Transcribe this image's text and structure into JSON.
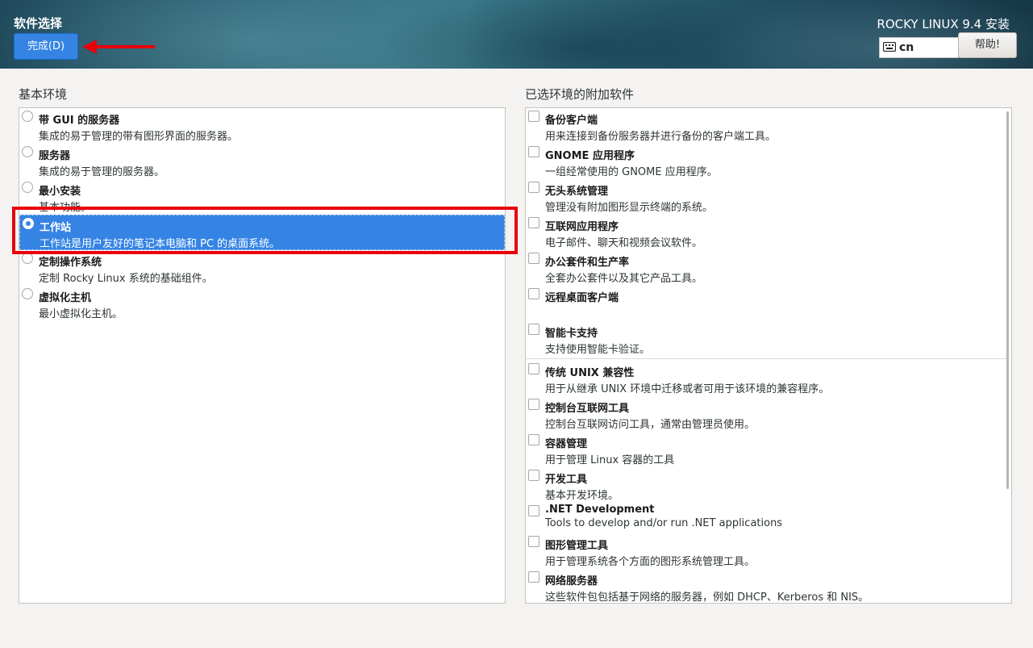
{
  "header": {
    "spoke_title": "软件选择",
    "done_label": "完成(D)",
    "product_title": "ROCKY LINUX 9.4 安装",
    "keyboard_layout": "cn",
    "help_label": "帮助!"
  },
  "base_env": {
    "label": "基本环境",
    "items": [
      {
        "name": "带 GUI 的服务器",
        "desc": "集成的易于管理的带有图形界面的服务器。",
        "selected": false
      },
      {
        "name": "服务器",
        "desc": "集成的易于管理的服务器。",
        "selected": false
      },
      {
        "name": "最小安装",
        "desc": "基本功能。",
        "selected": false
      },
      {
        "name": "工作站",
        "desc": "工作站是用户友好的笔记本电脑和 PC 的桌面系统。",
        "selected": true
      },
      {
        "name": "定制操作系统",
        "desc": "定制 Rocky Linux 系统的基础组件。",
        "selected": false
      },
      {
        "name": "虚拟化主机",
        "desc": "最小虚拟化主机。",
        "selected": false
      }
    ]
  },
  "addons": {
    "label": "已选环境的附加软件",
    "items": [
      {
        "name": "备份客户端",
        "desc": "用来连接到备份服务器并进行备份的客户端工具。"
      },
      {
        "name": "GNOME 应用程序",
        "desc": "一组经常使用的 GNOME 应用程序。"
      },
      {
        "name": "无头系统管理",
        "desc": "管理没有附加图形显示终端的系统。"
      },
      {
        "name": "互联网应用程序",
        "desc": "电子邮件、聊天和视频会议软件。"
      },
      {
        "name": "办公套件和生产率",
        "desc": "全套办公套件以及其它产品工具。"
      },
      {
        "name": "远程桌面客户端",
        "desc": ""
      },
      {
        "name": "智能卡支持",
        "desc": "支持使用智能卡验证。"
      },
      {
        "name": "传统 UNIX 兼容性",
        "desc": "用于从继承 UNIX 环境中迁移或者可用于该环境的兼容程序。"
      },
      {
        "name": "控制台互联网工具",
        "desc": "控制台互联网访问工具，通常由管理员使用。"
      },
      {
        "name": "容器管理",
        "desc": "用于管理 Linux 容器的工具"
      },
      {
        "name": "开发工具",
        "desc": "基本开发环境。"
      },
      {
        "name": ".NET Development",
        "desc": "Tools to develop and/or run .NET applications"
      },
      {
        "name": "图形管理工具",
        "desc": "用于管理系统各个方面的图形系统管理工具。"
      },
      {
        "name": "网络服务器",
        "desc": "这些软件包包括基于网络的服务器，例如 DHCP、Kerberos 和 NIS。"
      }
    ]
  },
  "colors": {
    "accent": "#3584e4",
    "annotation": "#e8000b"
  }
}
